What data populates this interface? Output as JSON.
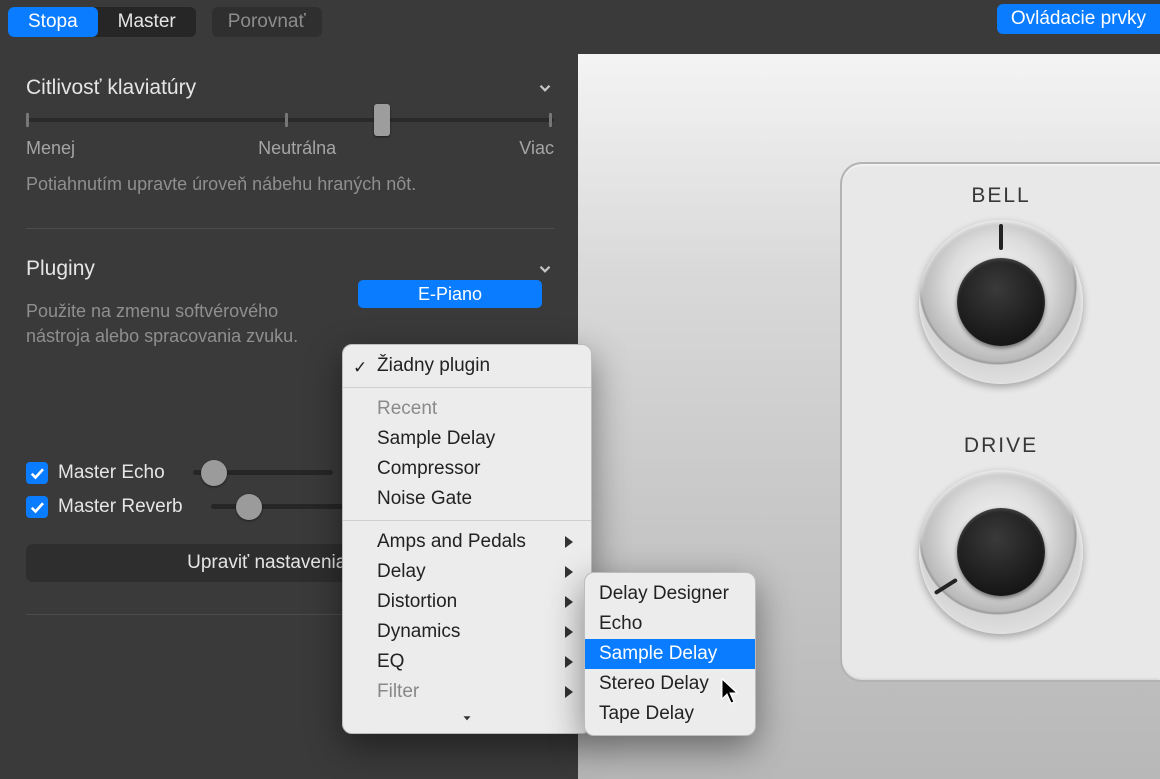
{
  "topbar": {
    "tab_stopa": "Stopa",
    "tab_master": "Master",
    "compare": "Porovnať",
    "controls": "Ovládacie prvky"
  },
  "keyboard_sensitivity": {
    "title": "Citlivosť klaviatúry",
    "label_less": "Menej",
    "label_neutral": "Neutrálna",
    "label_more": "Viac",
    "help": "Potiahnutím upravte úroveň nábehu hraných nôt.",
    "value_percent": 66
  },
  "plugins": {
    "title": "Pluginy",
    "help": "Použite na zmenu softvérového nástroja alebo spracovania zvuku.",
    "slot_label": "E-Piano"
  },
  "master_effects": {
    "echo_label": "Master Echo",
    "echo_checked": true,
    "echo_value_percent": 6,
    "reverb_label": "Master Reverb",
    "reverb_checked": true,
    "reverb_value_percent": 18,
    "edit_button": "Upraviť nastavenia echa"
  },
  "instrument": {
    "knob1_label": "BELL",
    "knob2_label": "DRIVE"
  },
  "plugin_menu": {
    "none": "Žiadny plugin",
    "recent_heading": "Recent",
    "recent_items": [
      "Sample Delay",
      "Compressor",
      "Noise Gate"
    ],
    "categories": [
      "Amps and Pedals",
      "Delay",
      "Distortion",
      "Dynamics",
      "EQ",
      "Filter"
    ]
  },
  "delay_submenu": {
    "items": [
      "Delay Designer",
      "Echo",
      "Sample Delay",
      "Stereo Delay",
      "Tape Delay"
    ],
    "selected_index": 2
  }
}
